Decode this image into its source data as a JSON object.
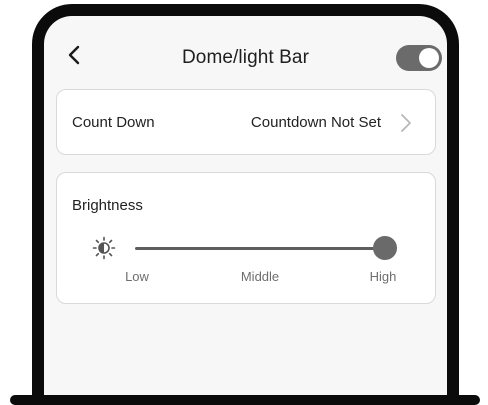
{
  "header": {
    "title": "Dome/light Bar",
    "power_on": true
  },
  "countdown": {
    "label": "Count Down",
    "value": "Countdown Not Set"
  },
  "brightness": {
    "label": "Brightness",
    "level": 1.0,
    "ticks": [
      "Low",
      "Middle",
      "High"
    ]
  },
  "colors": {
    "frame": "#0b0b0b",
    "screen_bg": "#f7f7f8",
    "card_border": "#d9d9d9",
    "toggle_on": "#6b6b6b",
    "slider": "#5e5e5e",
    "tick_text": "#6e6e6e"
  },
  "icons": {
    "back": "chevron-left-icon",
    "row_arrow": "chevron-right-icon",
    "brightness": "sun-half-icon"
  }
}
